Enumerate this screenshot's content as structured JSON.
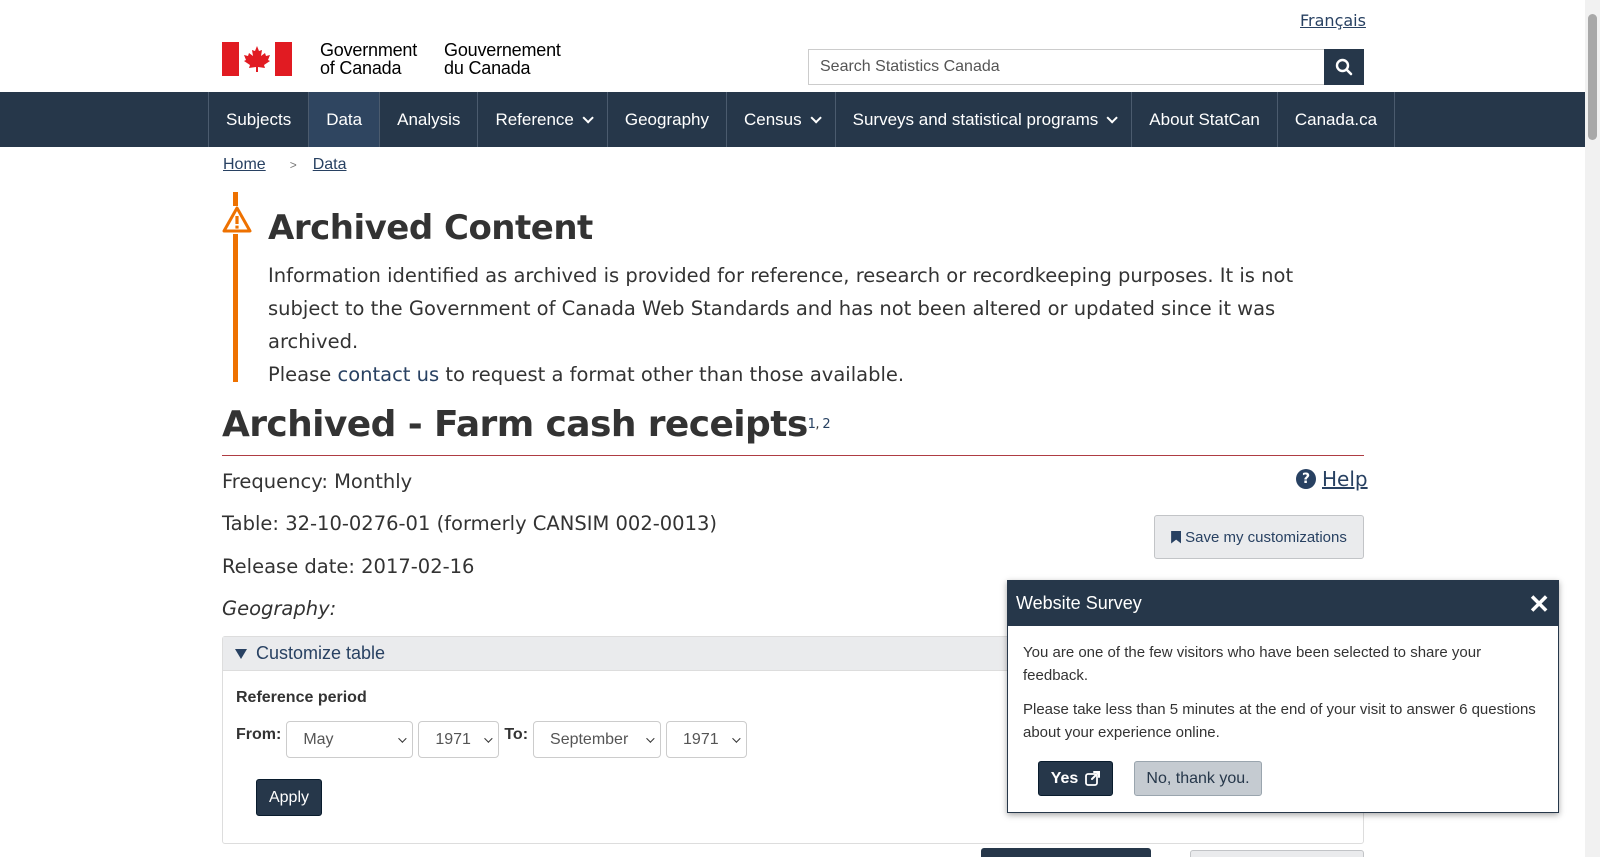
{
  "header": {
    "language_link": "Français",
    "fip_en_line1": "Government",
    "fip_en_line2": "of Canada",
    "fip_fr_line1": "Gouvernement",
    "fip_fr_line2": "du Canada",
    "search_placeholder": "Search Statistics Canada"
  },
  "menu": {
    "items": [
      {
        "label": "Subjects"
      },
      {
        "label": "Data"
      },
      {
        "label": "Analysis"
      },
      {
        "label": "Reference"
      },
      {
        "label": "Geography"
      },
      {
        "label": "Census"
      },
      {
        "label": "Surveys and statistical programs"
      },
      {
        "label": "About StatCan"
      },
      {
        "label": "Canada.ca"
      }
    ]
  },
  "breadcrumb": {
    "home": "Home",
    "separator": ">",
    "data": "Data"
  },
  "archived": {
    "title": "Archived Content",
    "body": "Information identified as archived is provided for reference, research or recordkeeping purposes. It is not subject to the Government of Canada Web Standards and has not been altered or updated since it was archived.",
    "please": "Please",
    "contact_link": "contact us",
    "tail": "to request a format other than those available."
  },
  "page": {
    "title": "Archived - Farm cash receipts",
    "footnote1": "1",
    "footnote_sep": ",",
    "footnote2": "2",
    "frequency": "Frequency: Monthly",
    "table": "Table: 32-10-0276-01 (formerly CANSIM 002-0013)",
    "release_date": "Release date: 2017-02-16",
    "geography": "Geography:",
    "help": "Help",
    "save_customizations": "Save my customizations"
  },
  "customize": {
    "summary": "Customize table",
    "reference_period": "Reference period",
    "from_label": "From:",
    "to_label": "To:",
    "from_month": "May",
    "from_year": "1971",
    "to_month": "September",
    "to_year": "1971",
    "apply": "Apply"
  },
  "survey": {
    "title": "Website Survey",
    "close": "✕",
    "line1": "You are one of the few visitors who have been selected to share your feedback.",
    "line2": "Please take less than 5 minutes at the end of your visit to answer 6 questions about your experience online.",
    "yes": "Yes",
    "no": "No, thank you."
  },
  "colors": {
    "nav": "#26374a",
    "accent_red": "#af3c43",
    "archive_orange": "#ee7100",
    "flag_red": "#e11b22",
    "link": "#284162"
  }
}
